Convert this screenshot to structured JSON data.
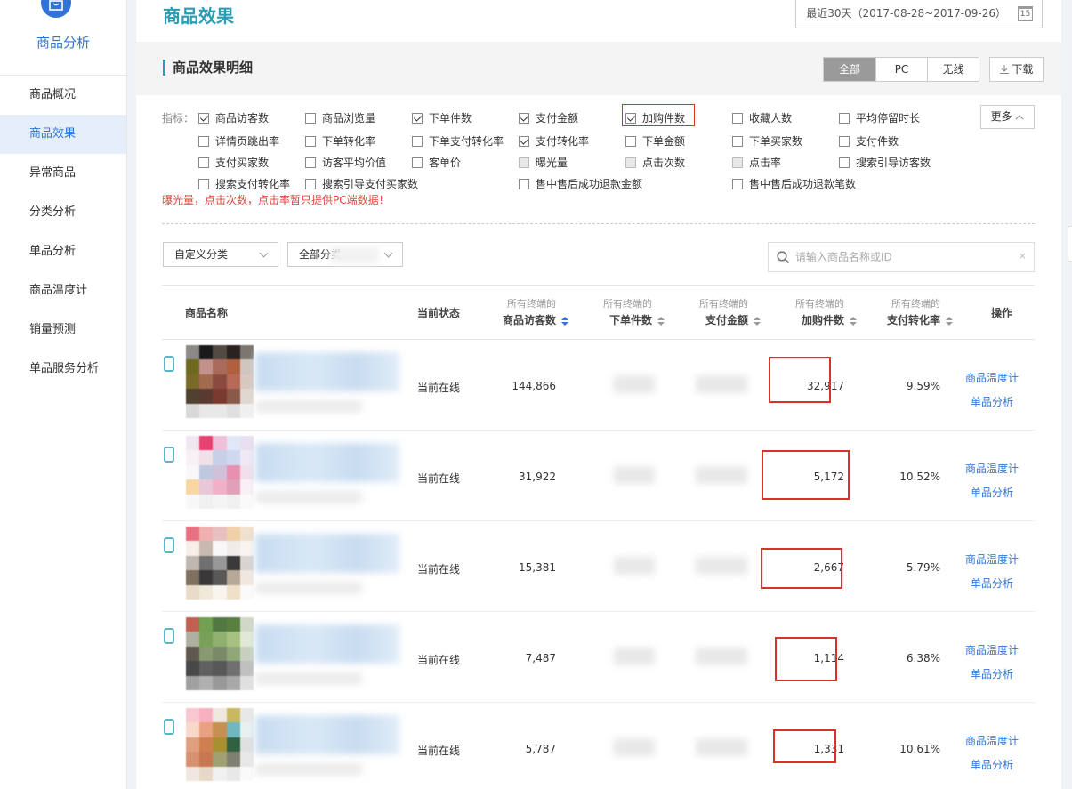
{
  "sidebar": {
    "title": "商品分析",
    "items": [
      {
        "label": "商品概况",
        "active": false
      },
      {
        "label": "商品效果",
        "active": true
      },
      {
        "label": "异常商品",
        "active": false
      },
      {
        "label": "分类分析",
        "active": false
      },
      {
        "label": "单品分析",
        "active": false
      },
      {
        "label": "商品温度计",
        "active": false
      },
      {
        "label": "销量预测",
        "active": false
      },
      {
        "label": "单品服务分析",
        "active": false
      }
    ]
  },
  "header": {
    "title": "商品效果",
    "date_range": "最近30天（2017-08-28~2017-09-26）",
    "calendar_day": "15"
  },
  "section": {
    "title": "商品效果明细",
    "segments": [
      "全部",
      "PC",
      "无线"
    ],
    "download": "下载",
    "icons": {
      "download": "download-icon",
      "calendar": "calendar-icon",
      "search": "search-icon"
    }
  },
  "indicators": {
    "label": "指标：",
    "more": "更多",
    "warning": "曝光量，点击次数，点击率暂只提供PC端数据！",
    "items": [
      {
        "label": "商品访客数",
        "checked": true
      },
      {
        "label": "商品浏览量",
        "checked": false
      },
      {
        "label": "下单件数",
        "checked": true
      },
      {
        "label": "支付金额",
        "checked": true
      },
      {
        "label": "加购件数",
        "checked": true
      },
      {
        "label": "收藏人数",
        "checked": false
      },
      {
        "label": "平均停留时长",
        "checked": false
      },
      {
        "label": "详情页跳出率",
        "checked": false
      },
      {
        "label": "下单转化率",
        "checked": false
      },
      {
        "label": "下单支付转化率",
        "checked": false
      },
      {
        "label": "支付转化率",
        "checked": true
      },
      {
        "label": "下单金额",
        "checked": false
      },
      {
        "label": "下单买家数",
        "checked": false
      },
      {
        "label": "支付件数",
        "checked": false
      },
      {
        "label": "支付买家数",
        "checked": false
      },
      {
        "label": "访客平均价值",
        "checked": false
      },
      {
        "label": "客单价",
        "checked": false
      },
      {
        "label": "曝光量",
        "checked": false,
        "disabled": true
      },
      {
        "label": "点击次数",
        "checked": false,
        "disabled": true
      },
      {
        "label": "点击率",
        "checked": false,
        "disabled": true
      },
      {
        "label": "搜索引导访客数",
        "checked": false
      },
      {
        "label": "搜索支付转化率",
        "checked": false
      },
      {
        "label": "搜索引导支付买家数",
        "checked": false
      },
      {
        "label": "售中售后成功退款金额",
        "checked": false
      },
      {
        "label": "售中售后成功退款笔数",
        "checked": false
      }
    ]
  },
  "filters": {
    "custom_category": "自定义分类",
    "all_category": "全部分类",
    "search_placeholder": "请输入商品名称或ID",
    "clear": "×"
  },
  "table": {
    "columns": {
      "name": "商品名称",
      "status": "当前状态",
      "visitors": {
        "sub": "所有终端的",
        "main": "商品访客数"
      },
      "orders": {
        "sub": "所有终端的",
        "main": "下单件数"
      },
      "payment": {
        "sub": "所有终端的",
        "main": "支付金额"
      },
      "cart": {
        "sub": "所有终端的",
        "main": "加购件数"
      },
      "conversion": {
        "sub": "所有终端的",
        "main": "支付转化率"
      },
      "action": "操作"
    },
    "rows": [
      {
        "status": "当前在线",
        "visitors": "144,866",
        "cart": "32,917",
        "conversion": "9.59%",
        "op1": "商品温度计",
        "op2": "单品分析"
      },
      {
        "status": "当前在线",
        "visitors": "31,922",
        "cart": "5,172",
        "conversion": "10.52%",
        "op1": "商品温度计",
        "op2": "单品分析"
      },
      {
        "status": "当前在线",
        "visitors": "15,381",
        "cart": "2,667",
        "conversion": "5.79%",
        "op1": "商品温度计",
        "op2": "单品分析"
      },
      {
        "status": "当前在线",
        "visitors": "7,487",
        "cart": "1,114",
        "conversion": "6.38%",
        "op1": "商品温度计",
        "op2": "单品分析"
      },
      {
        "status": "当前在线",
        "visitors": "5,787",
        "cart": "1,331",
        "conversion": "10.61%",
        "op1": "商品温度计",
        "op2": "单品分析"
      }
    ]
  }
}
